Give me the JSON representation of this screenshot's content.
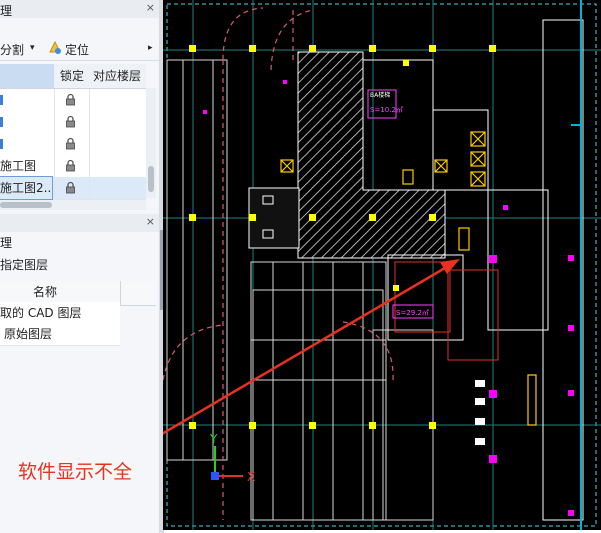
{
  "layer_panel": {
    "title_fragment": "理",
    "toolbar": {
      "split_label": "分割",
      "split_arrow": "▾",
      "locate_label": "定位",
      "more": "▸"
    },
    "columns": {
      "lock": "锁定",
      "floor": "对应楼层"
    },
    "rows": [
      {
        "name": "",
        "locked": true,
        "selected": false
      },
      {
        "name": "",
        "locked": true,
        "selected": false
      },
      {
        "name": "",
        "locked": true,
        "selected": false
      },
      {
        "name": "施工图",
        "locked": true,
        "selected": false
      },
      {
        "name": "施工图2...",
        "locked": true,
        "selected": true
      }
    ],
    "close": "×"
  },
  "layer_filter_panel": {
    "title_fragment": "理",
    "option": "指定图层",
    "column_name": "名称",
    "items": [
      "取的 CAD 图层",
      "原始图层"
    ],
    "close": "×"
  },
  "canvas": {
    "labels": {
      "room_a": "BA楼梯",
      "area_a": "S=10.2㎡",
      "area_b": "S=29.2㎡"
    },
    "axis": {
      "y": "Y",
      "x": "X"
    },
    "annotation": "软件显示不全"
  },
  "colors": {
    "annotation_red": "#e8321e",
    "cad_bg": "#000000",
    "cad_yellow": "#ffff00",
    "cad_magenta": "#ff00ff",
    "cad_cyan": "#00c8ff"
  }
}
